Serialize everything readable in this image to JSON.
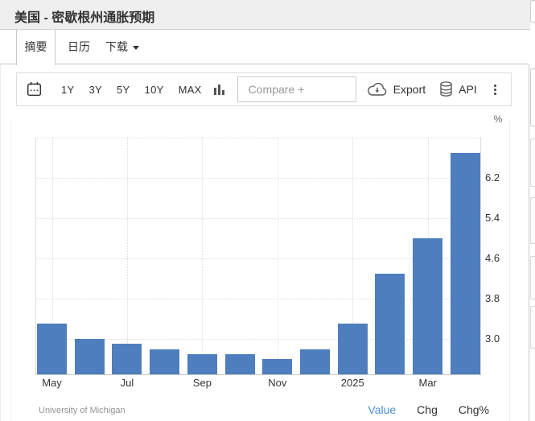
{
  "title": "美国 - 密歇根州通胀预期",
  "tabs": [
    {
      "label": "摘要",
      "active": true
    },
    {
      "label": "日历",
      "active": false
    },
    {
      "label": "下载",
      "active": false,
      "has_caret": true
    }
  ],
  "toolbar": {
    "ranges": [
      "1Y",
      "3Y",
      "5Y",
      "10Y",
      "MAX"
    ],
    "compare_label": "Compare +",
    "export_label": "Export",
    "api_label": "API",
    "icons": [
      "calendar-icon",
      "bar-chart-icon",
      "cloud-download-icon",
      "database-icon",
      "kebab-menu-icon"
    ]
  },
  "chart_data": {
    "type": "bar",
    "title": "美国 - 密歇根州通胀预期",
    "unit": "%",
    "x": [
      "May 2024",
      "Jun 2024",
      "Jul 2024",
      "Aug 2024",
      "Sep 2024",
      "Oct 2024",
      "Nov 2024",
      "Dec 2024",
      "Jan 2025",
      "Feb 2025",
      "Mar 2025",
      "Apr 2025"
    ],
    "values": [
      3.3,
      3.0,
      2.9,
      2.8,
      2.7,
      2.7,
      2.6,
      2.8,
      3.3,
      4.3,
      5.0,
      6.7
    ],
    "x_tick_labels": [
      "May",
      "Jul",
      "Sep",
      "Nov",
      "2025",
      "Mar"
    ],
    "y_ticks": [
      3.0,
      3.8,
      4.6,
      5.4,
      6.2
    ],
    "ylim": [
      2.26,
      7.0
    ],
    "bar_color": "#4e7ebd",
    "grid": true,
    "legend": null,
    "source": "University of Michigan"
  },
  "footer": {
    "source": "University of Michigan",
    "links": [
      {
        "label": "Value",
        "active": true
      },
      {
        "label": "Chg",
        "active": false
      },
      {
        "label": "Chg%",
        "active": false
      }
    ]
  }
}
